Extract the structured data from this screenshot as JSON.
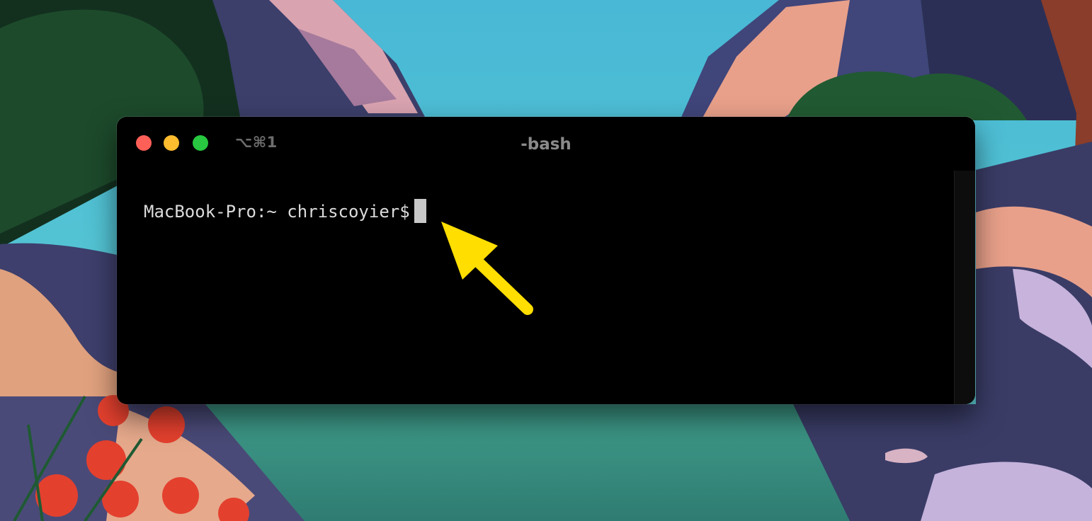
{
  "window": {
    "title": "-bash",
    "shortcut": "⌥⌘1",
    "traffic_lights": {
      "close_color": "#fe5f57",
      "minimize_color": "#febc2e",
      "zoom_color": "#28c840"
    }
  },
  "terminal": {
    "prompt": "MacBook-Pro:~ chriscoyier$",
    "cursor": "block"
  },
  "annotation": {
    "icon": "arrow-icon",
    "color": "#ffde00"
  },
  "colors": {
    "terminal_background": "#000000",
    "text": "#dcdcdc"
  }
}
